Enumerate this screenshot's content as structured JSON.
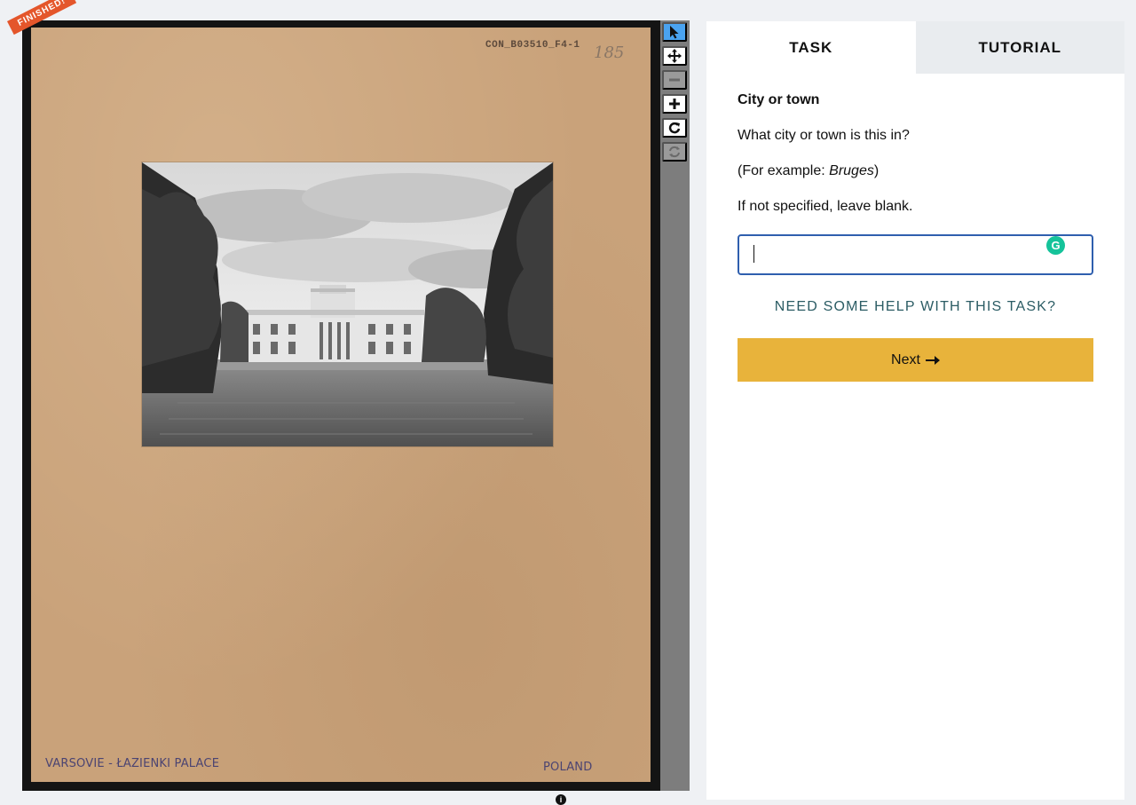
{
  "subject": {
    "badge": "FINISHED!",
    "catalog_stamp": "CON_B03510_F4-1",
    "pencil_number": "185",
    "caption_left": "VARSOVIE - ŁAZIENKI PALACE",
    "caption_right": "POLAND"
  },
  "toolbar": {
    "tools": [
      {
        "name": "select",
        "icon": "pointer-icon",
        "state": "active"
      },
      {
        "name": "pan",
        "icon": "move-icon",
        "state": "normal"
      },
      {
        "name": "zoom-out",
        "icon": "minus-icon",
        "state": "disabled"
      },
      {
        "name": "zoom-in",
        "icon": "plus-icon",
        "state": "normal"
      },
      {
        "name": "rotate",
        "icon": "rotate-icon",
        "state": "normal"
      },
      {
        "name": "reset",
        "icon": "reset-icon",
        "state": "disabled"
      }
    ]
  },
  "panel": {
    "tabs": [
      "TASK",
      "TUTORIAL"
    ],
    "active_tab": "TASK",
    "question_title": "City or town",
    "question_text": "What city or town is this in?",
    "example_prefix": "(For example: ",
    "example_value": "Bruges",
    "example_suffix": ")",
    "instruction": "If not specified, leave blank.",
    "answer_value": "",
    "grammar_badge": "G",
    "help_link": "NEED SOME HELP WITH THIS TASK?",
    "next_label": "Next",
    "next_icon": "arrow-right-icon"
  },
  "colors": {
    "accent_button": "#e8b33b",
    "input_border": "#2f5fae",
    "help_link": "#2b5c64",
    "badge": "#e4562b",
    "active_tool": "#4aa3f0"
  }
}
